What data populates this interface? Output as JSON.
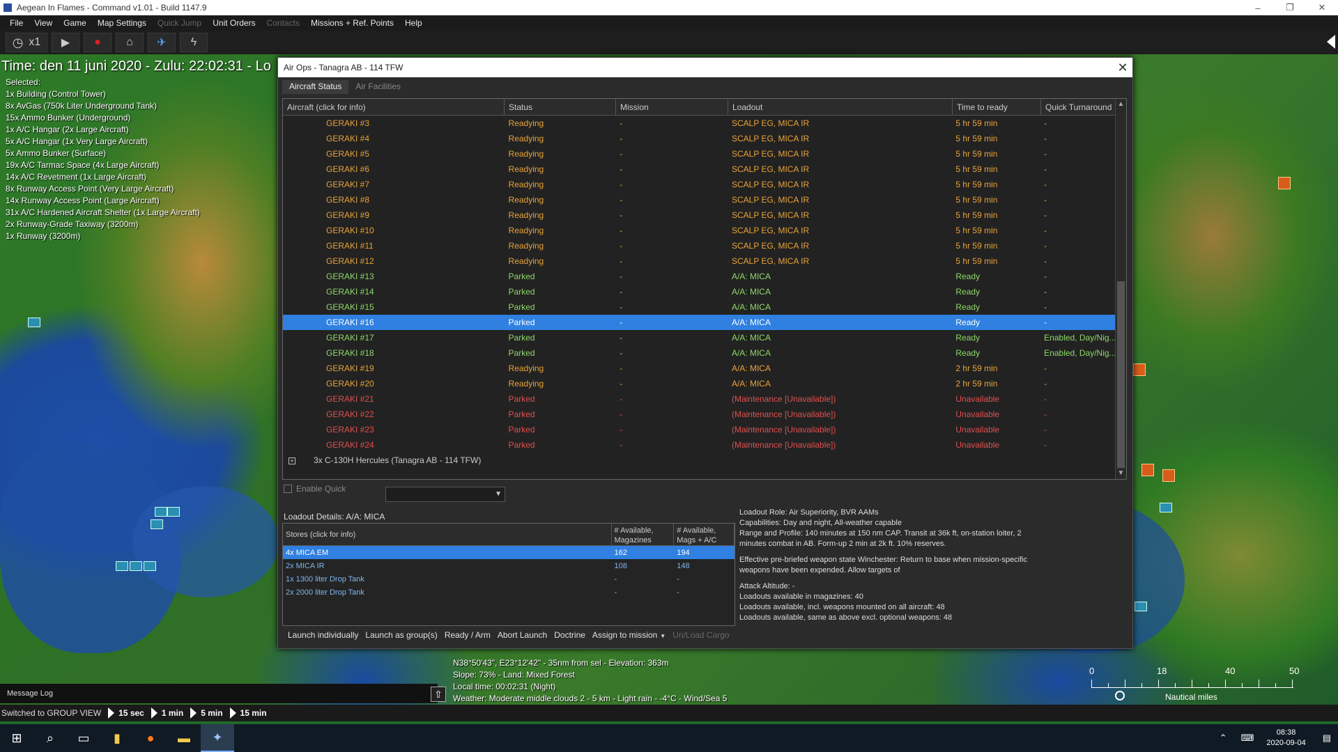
{
  "window": {
    "title": "Aegean In Flames - Command v1.01 - Build 1147.9",
    "controls": [
      "–",
      "❐",
      "✕"
    ]
  },
  "menu": [
    {
      "label": "File",
      "enabled": true
    },
    {
      "label": "View",
      "enabled": true
    },
    {
      "label": "Game",
      "enabled": true
    },
    {
      "label": "Map Settings",
      "enabled": true
    },
    {
      "label": "Quick Jump",
      "enabled": false
    },
    {
      "label": "Unit Orders",
      "enabled": true
    },
    {
      "label": "Contacts",
      "enabled": false
    },
    {
      "label": "Missions + Ref. Points",
      "enabled": true
    },
    {
      "label": "Help",
      "enabled": true
    }
  ],
  "toolbar": {
    "speed_label": "x1"
  },
  "time_display": "Time: den 11 juni 2020 - Zulu: 22:02:31 - Lo",
  "selected": {
    "header": "Selected:",
    "items": [
      "1x Building (Control Tower)",
      "8x AvGas (750k Liter Underground Tank)",
      "15x Ammo Bunker (Underground)",
      "1x A/C Hangar (2x Large Aircraft)",
      "5x A/C Hangar (1x Very Large Aircraft)",
      "5x Ammo Bunker (Surface)",
      "19x A/C Tarmac Space (4x Large Aircraft)",
      "14x A/C Revetment (1x Large Aircraft)",
      "8x Runway Access Point (Very Large Aircraft)",
      "14x Runway Access Point (Large Aircraft)",
      "31x A/C Hardened Aircraft Shelter (1x Large Aircraft)",
      "2x Runway-Grade Taxiway (3200m)",
      "1x Runway (3200m)"
    ]
  },
  "dialog": {
    "title": "Air Ops - Tanagra AB - 114 TFW",
    "tabs": [
      "Aircraft Status",
      "Air Facilities"
    ],
    "active_tab": "Aircraft Status",
    "columns": [
      "Aircraft (click for info)",
      "Status",
      "Mission",
      "Loadout",
      "Time to ready",
      "Quick Turnaround"
    ],
    "colors": {
      "readying": "#e8a33a",
      "parked": "#8fd86a",
      "unavailable": "#e05050"
    },
    "rows": [
      {
        "aircraft": "GERAKI #3",
        "status": "Readying",
        "mission": "-",
        "loadout": "SCALP EG, MICA IR",
        "time": "5 hr 59 min",
        "quick": "-",
        "state": "readying"
      },
      {
        "aircraft": "GERAKI #4",
        "status": "Readying",
        "mission": "-",
        "loadout": "SCALP EG, MICA IR",
        "time": "5 hr 59 min",
        "quick": "-",
        "state": "readying"
      },
      {
        "aircraft": "GERAKI #5",
        "status": "Readying",
        "mission": "-",
        "loadout": "SCALP EG, MICA IR",
        "time": "5 hr 59 min",
        "quick": "-",
        "state": "readying"
      },
      {
        "aircraft": "GERAKI #6",
        "status": "Readying",
        "mission": "-",
        "loadout": "SCALP EG, MICA IR",
        "time": "5 hr 59 min",
        "quick": "-",
        "state": "readying"
      },
      {
        "aircraft": "GERAKI #7",
        "status": "Readying",
        "mission": "-",
        "loadout": "SCALP EG, MICA IR",
        "time": "5 hr 59 min",
        "quick": "-",
        "state": "readying"
      },
      {
        "aircraft": "GERAKI #8",
        "status": "Readying",
        "mission": "-",
        "loadout": "SCALP EG, MICA IR",
        "time": "5 hr 59 min",
        "quick": "-",
        "state": "readying"
      },
      {
        "aircraft": "GERAKI #9",
        "status": "Readying",
        "mission": "-",
        "loadout": "SCALP EG, MICA IR",
        "time": "5 hr 59 min",
        "quick": "-",
        "state": "readying"
      },
      {
        "aircraft": "GERAKI #10",
        "status": "Readying",
        "mission": "-",
        "loadout": "SCALP EG, MICA IR",
        "time": "5 hr 59 min",
        "quick": "-",
        "state": "readying"
      },
      {
        "aircraft": "GERAKI #11",
        "status": "Readying",
        "mission": "-",
        "loadout": "SCALP EG, MICA IR",
        "time": "5 hr 59 min",
        "quick": "-",
        "state": "readying"
      },
      {
        "aircraft": "GERAKI #12",
        "status": "Readying",
        "mission": "-",
        "loadout": "SCALP EG, MICA IR",
        "time": "5 hr 59 min",
        "quick": "-",
        "state": "readying"
      },
      {
        "aircraft": "GERAKI #13",
        "status": "Parked",
        "mission": "-",
        "loadout": "A/A: MICA",
        "time": "Ready",
        "quick": "-",
        "state": "parked"
      },
      {
        "aircraft": "GERAKI #14",
        "status": "Parked",
        "mission": "-",
        "loadout": "A/A: MICA",
        "time": "Ready",
        "quick": "-",
        "state": "parked"
      },
      {
        "aircraft": "GERAKI #15",
        "status": "Parked",
        "mission": "-",
        "loadout": "A/A: MICA",
        "time": "Ready",
        "quick": "-",
        "state": "parked"
      },
      {
        "aircraft": "GERAKI #16",
        "status": "Parked",
        "mission": "-",
        "loadout": "A/A: MICA",
        "time": "Ready",
        "quick": "-",
        "state": "selected"
      },
      {
        "aircraft": "GERAKI #17",
        "status": "Parked",
        "mission": "-",
        "loadout": "A/A: MICA",
        "time": "Ready",
        "quick": "Enabled, Day/Nig...",
        "state": "parked"
      },
      {
        "aircraft": "GERAKI #18",
        "status": "Parked",
        "mission": "-",
        "loadout": "A/A: MICA",
        "time": "Ready",
        "quick": "Enabled, Day/Nig...",
        "state": "parked"
      },
      {
        "aircraft": "GERAKI #19",
        "status": "Readying",
        "mission": "-",
        "loadout": "A/A: MICA",
        "time": "2 hr 59 min",
        "quick": "-",
        "state": "readying"
      },
      {
        "aircraft": "GERAKI #20",
        "status": "Readying",
        "mission": "-",
        "loadout": "A/A: MICA",
        "time": "2 hr 59 min",
        "quick": "-",
        "state": "readying"
      },
      {
        "aircraft": "GERAKI #21",
        "status": "Parked",
        "mission": "-",
        "loadout": "(Maintenance [Unavailable])",
        "time": "Unavailable",
        "quick": "-",
        "state": "unavailable"
      },
      {
        "aircraft": "GERAKI #22",
        "status": "Parked",
        "mission": "-",
        "loadout": "(Maintenance [Unavailable])",
        "time": "Unavailable",
        "quick": "-",
        "state": "unavailable"
      },
      {
        "aircraft": "GERAKI #23",
        "status": "Parked",
        "mission": "-",
        "loadout": "(Maintenance [Unavailable])",
        "time": "Unavailable",
        "quick": "-",
        "state": "unavailable"
      },
      {
        "aircraft": "GERAKI #24",
        "status": "Parked",
        "mission": "-",
        "loadout": "(Maintenance [Unavailable])",
        "time": "Unavailable",
        "quick": "-",
        "state": "unavailable"
      }
    ],
    "group_row": {
      "expander": "+",
      "label": "3x C-130H Hercules (Tanagra AB - 114 TFW)"
    },
    "enable_quick_label": "Enable Quick",
    "loadout_details_title": "Loadout Details: A/A: MICA",
    "stores_columns": [
      "Stores (click for info)",
      "# Available, Magazines",
      "# Available, Mags + A/C"
    ],
    "stores": [
      {
        "name": "4x MICA EM",
        "mags": "162",
        "mags_ac": "194",
        "selected": true
      },
      {
        "name": "2x MICA IR",
        "mags": "108",
        "mags_ac": "148",
        "selected": false
      },
      {
        "name": "1x 1300 liter Drop Tank",
        "mags": "-",
        "mags_ac": "-",
        "selected": false
      },
      {
        "name": "2x 2000 liter Drop Tank",
        "mags": "-",
        "mags_ac": "-",
        "selected": false
      }
    ],
    "details": {
      "role": "Loadout Role: Air Superiority, BVR AAMs",
      "capabilities": "Capabilities: Day and night, All-weather capable",
      "range": "Range and Profile: 140 minutes at 150 nm CAP. Transit at 36k ft, on-station loiter, 2 minutes combat in AB. Form-up 2 min at 2k ft. 10% reserves.",
      "winchester": "Effective pre-briefed weapon state Winchester: Return to base when mission-specific weapons have been expended. Allow targets of",
      "attack_altitude": "Attack Altitude: -",
      "avail_mag": "Loadouts available in magazines: 40",
      "avail_all": "Loadouts available, incl. weapons mounted on all aircraft: 48",
      "avail_excl": "Loadouts available, same as above excl. optional weapons: 48"
    },
    "actions": [
      {
        "label": "Launch individually",
        "enabled": true
      },
      {
        "label": "Launch as group(s)",
        "enabled": true
      },
      {
        "label": "Ready / Arm",
        "enabled": true
      },
      {
        "label": "Abort Launch",
        "enabled": true
      },
      {
        "label": "Doctrine",
        "enabled": true
      },
      {
        "label": "Assign to mission",
        "enabled": true,
        "dropdown": true
      },
      {
        "label": "Un/Load Cargo",
        "enabled": false
      }
    ]
  },
  "map_info": {
    "coords": "N38°50'43\", E23°12'42\" - 35nm from sel - Elevation: 363m",
    "slope": "Slope: 73%  - Land: Mixed Forest",
    "local_time": "Local time: 00:02:31 (Night)",
    "weather": "Weather: Moderate middle clouds 2 - 5 km - Light rain - -4°C - Wind/Sea 5"
  },
  "scale": {
    "labels": [
      "0",
      "18",
      "40",
      "50"
    ],
    "unit": "Nautical miles"
  },
  "message_log": "Message Log",
  "status_bar": {
    "text": "Switched to GROUP VIEW",
    "speeds": [
      "15 sec",
      "1 min",
      "5 min",
      "15 min"
    ]
  },
  "taskbar": {
    "time": "08:38",
    "date": "2020-09-04"
  }
}
